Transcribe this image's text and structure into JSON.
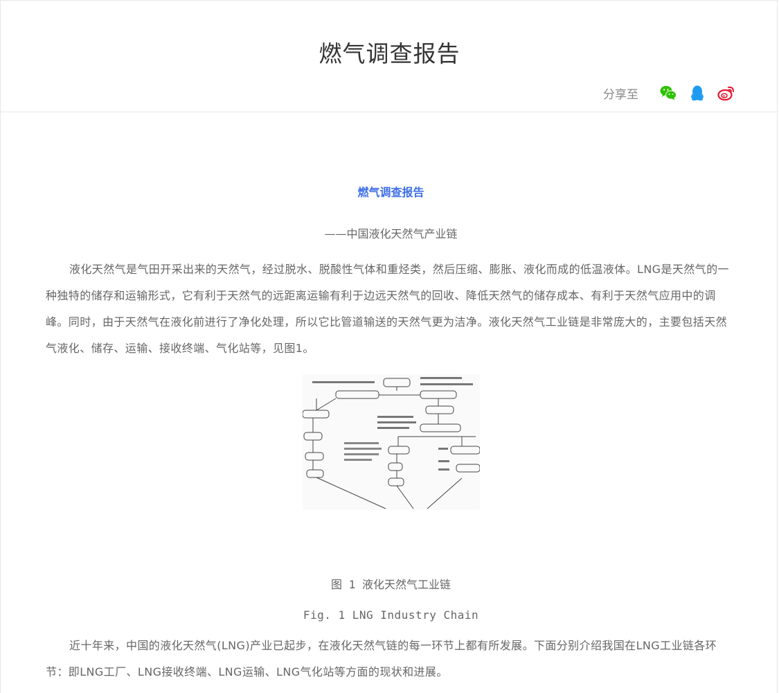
{
  "header": {
    "title": "燃气调查报告",
    "share_label": "分享至",
    "share_icons": [
      "wechat-icon",
      "qq-icon",
      "weibo-icon"
    ]
  },
  "article": {
    "title": "燃气调查报告",
    "subtitle": "——中国液化天然气产业链",
    "paragraph1": "液化天然气是气田开采出来的天然气，经过脱水、脱酸性气体和重烃类，然后压缩、膨胀、液化而成的低温液体。LNG是天然气的一种独特的储存和运输形式，它有利于天然气的远距离运输有利于边远天然气的回收、降低天然气的储存成本、有利于天然气应用中的调峰。同时，由于天然气在液化前进行了净化处理，所以它比管道输送的天然气更为洁净。液化天然气工业链是非常庞大的，主要包括天然气液化、储存、运输、接收终端、气化站等，见图1。",
    "figure_caption_cn": "图 1 液化天然气工业链",
    "figure_caption_en": "Fig. 1 LNG Industry Chain",
    "paragraph2": "近十年来，中国的液化天然气(LNG)产业已起步，在液化天然气链的每一环节上都有所发展。下面分别介绍我国在LNG工业链各环节：即LNG工厂、LNG接收终端、LNG运输、LNG气化站等方面的现状和进展。"
  },
  "colors": {
    "accent": "#3f6fe8",
    "wechat": "#2dc100",
    "qq": "#1e9bf0",
    "weibo": "#e6162d"
  }
}
